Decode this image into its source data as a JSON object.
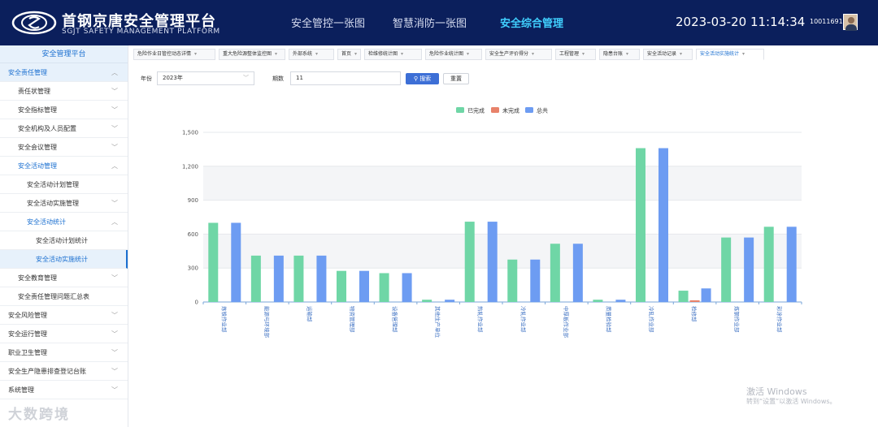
{
  "header": {
    "title": "首钢京唐安全管理平台",
    "subtitle": "SGJT SAFETY MANAGEMENT PLATFORM",
    "nav": [
      "安全管控一张图",
      "智慧消防一张图",
      "安全综合管理"
    ],
    "active_nav": 2,
    "datetime": "2023-03-20 11:14:34",
    "user_id": "10011691"
  },
  "sidebar": {
    "title": "安全管理平台",
    "items": [
      {
        "label": "安全责任管理",
        "level": 0,
        "chevron": "up",
        "state": "blue-bg"
      },
      {
        "label": "责任状管理",
        "level": 1,
        "chevron": "down",
        "state": ""
      },
      {
        "label": "安全指标管理",
        "level": 1,
        "chevron": "down",
        "state": ""
      },
      {
        "label": "安全机构及人员配置",
        "level": 1,
        "chevron": "down",
        "state": ""
      },
      {
        "label": "安全会议管理",
        "level": 1,
        "chevron": "down",
        "state": ""
      },
      {
        "label": "安全活动管理",
        "level": 1,
        "chevron": "up",
        "state": "blue"
      },
      {
        "label": "安全活动计划管理",
        "level": 2,
        "chevron": "",
        "state": ""
      },
      {
        "label": "安全活动实施管理",
        "level": 2,
        "chevron": "down",
        "state": ""
      },
      {
        "label": "安全活动统计",
        "level": 2,
        "chevron": "up",
        "state": "blue"
      },
      {
        "label": "安全活动计划统计",
        "level": 3,
        "chevron": "",
        "state": ""
      },
      {
        "label": "安全活动实施统计",
        "level": 3,
        "chevron": "",
        "state": "selected"
      },
      {
        "label": "安全教育管理",
        "level": 1,
        "chevron": "down",
        "state": ""
      },
      {
        "label": "安全责任管理问题汇总表",
        "level": 1,
        "chevron": "",
        "state": ""
      },
      {
        "label": "安全风险管理",
        "level": 0,
        "chevron": "down",
        "state": ""
      },
      {
        "label": "安全运行管理",
        "level": 0,
        "chevron": "down",
        "state": ""
      },
      {
        "label": "职业卫生管理",
        "level": 0,
        "chevron": "down",
        "state": ""
      },
      {
        "label": "安全生产隐患排查登记台账",
        "level": 0,
        "chevron": "down",
        "state": ""
      },
      {
        "label": "系统管理",
        "level": 0,
        "chevron": "down",
        "state": ""
      }
    ]
  },
  "tabs": [
    "危险作业日管控动态详情",
    "重大危险源整体监控图",
    "外部系统",
    "首页",
    "检维修统计图",
    "危险作业统计图",
    "安全生产评价得分",
    "工程管理",
    "隐患台账",
    "安全活动记录",
    "安全活动实施统计"
  ],
  "active_tab": 10,
  "filters": {
    "year_label": "年份",
    "year_value": "2023年",
    "period_label": "期数",
    "period_value": "11",
    "search_label": "搜索",
    "reset_label": "重置"
  },
  "chart_data": {
    "type": "bar",
    "legend": [
      "已完成",
      "未完成",
      "总共"
    ],
    "colors": [
      "#6fd6a6",
      "#e8826a",
      "#6d9cf2"
    ],
    "legend_position": "top",
    "ylim": [
      0,
      1500
    ],
    "yticks": [
      "0",
      "300",
      "600",
      "900",
      "1,200",
      "1,500"
    ],
    "grid": true,
    "categories": [
      "炼铁作业部",
      "能源与环境部",
      "运输部",
      "物资管理部",
      "设备管理部",
      "其他生产单位",
      "热轧作业部",
      "冷轧作业部",
      "中厚板作业部",
      "质量检验部",
      "冷轧作业部",
      "检修部",
      "炼钢作业部",
      "彩涂作业部"
    ],
    "series": [
      {
        "name": "已完成",
        "values": [
          700,
          410,
          410,
          275,
          255,
          20,
          710,
          375,
          515,
          20,
          1360,
          100,
          570,
          665
        ]
      },
      {
        "name": "未完成",
        "values": [
          0,
          0,
          0,
          0,
          0,
          0,
          0,
          0,
          0,
          0,
          0,
          15,
          0,
          0
        ]
      },
      {
        "name": "总共",
        "values": [
          700,
          410,
          410,
          275,
          255,
          20,
          710,
          375,
          515,
          20,
          1360,
          120,
          570,
          665
        ]
      }
    ]
  },
  "watermark": {
    "line1": "激活 Windows",
    "line2": "转到“设置”以激活 Windows。",
    "brand": "大数跨境"
  }
}
